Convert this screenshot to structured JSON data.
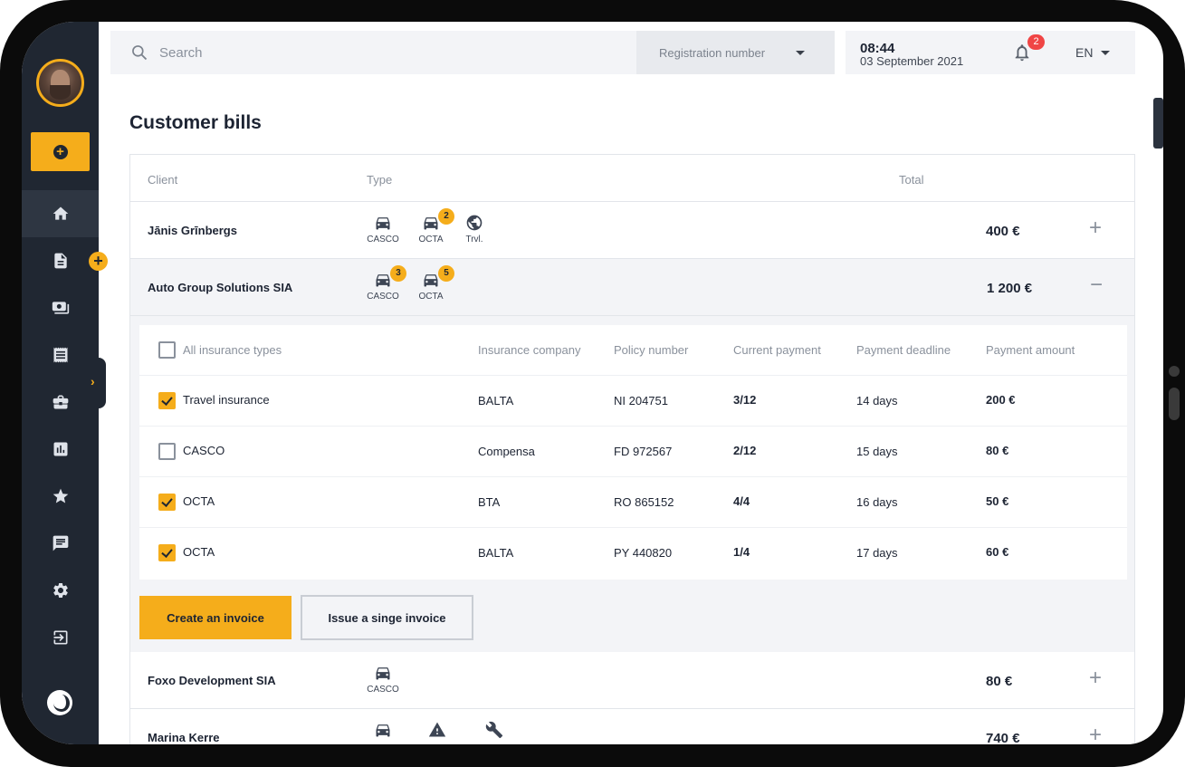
{
  "search": {
    "placeholder": "Search"
  },
  "registration": {
    "label": "Registration number"
  },
  "clock": {
    "time": "08:44",
    "date": "03 September 2021"
  },
  "notifications": {
    "count": "2"
  },
  "language": {
    "current": "EN"
  },
  "page": {
    "title": "Customer bills"
  },
  "table": {
    "headers": {
      "client": "Client",
      "type": "Type",
      "total": "Total"
    },
    "rows": [
      {
        "client": "Jānis Grīnbergs",
        "total": "400 €",
        "types": [
          {
            "label": "CASCO"
          },
          {
            "label": "OCTA",
            "count": "2"
          },
          {
            "label": "Trvl."
          }
        ]
      },
      {
        "client": "Auto Group Solutions SIA",
        "total": "1 200 €",
        "types": [
          {
            "label": "CASCO",
            "count": "3"
          },
          {
            "label": "OCTA",
            "count": "5"
          }
        ]
      },
      {
        "client": "Foxo Development SIA",
        "total": "80 €",
        "types": [
          {
            "label": "CASCO"
          }
        ]
      },
      {
        "client": "Marina Kerre",
        "total": "740 €"
      }
    ],
    "expand_symbol": "+",
    "collapse_symbol": "−"
  },
  "details": {
    "headers": {
      "all_types": "All insurance types",
      "company": "Insurance company",
      "policy": "Policy number",
      "current": "Current payment",
      "deadline": "Payment deadline",
      "amount": "Payment amount"
    },
    "rows": [
      {
        "type": "Travel insurance",
        "checked": true,
        "company": "BALTA",
        "policy": "NI 204751",
        "current": "3/12",
        "deadline": "14 days",
        "amount": "200 €"
      },
      {
        "type": "CASCO",
        "checked": false,
        "company": "Compensa",
        "policy": "FD 972567",
        "current": "2/12",
        "deadline": "15 days",
        "amount": "80 €"
      },
      {
        "type": "OCTA",
        "checked": true,
        "company": "BTA",
        "policy": "RO 865152",
        "current": "4/4",
        "deadline": "16 days",
        "amount": "50 €"
      },
      {
        "type": "OCTA",
        "checked": true,
        "company": "BALTA",
        "policy": "PY 440820",
        "current": "1/4",
        "deadline": "17 days",
        "amount": "60 €"
      }
    ],
    "buttons": {
      "create": "Create an invoice",
      "issue": "Issue a singe invoice"
    }
  },
  "icons": {
    "nav": [
      "home-icon",
      "document-icon",
      "payments-icon",
      "receipt-icon",
      "briefcase-icon",
      "chart-icon",
      "star-icon",
      "chat-icon",
      "settings-icon",
      "logout-icon"
    ],
    "types": [
      "car-icon",
      "globe-icon",
      "warning-icon",
      "tools-icon"
    ]
  },
  "colors": {
    "accent": "#f5ad1b",
    "sidebar": "#202732",
    "badge": "#f04545"
  }
}
